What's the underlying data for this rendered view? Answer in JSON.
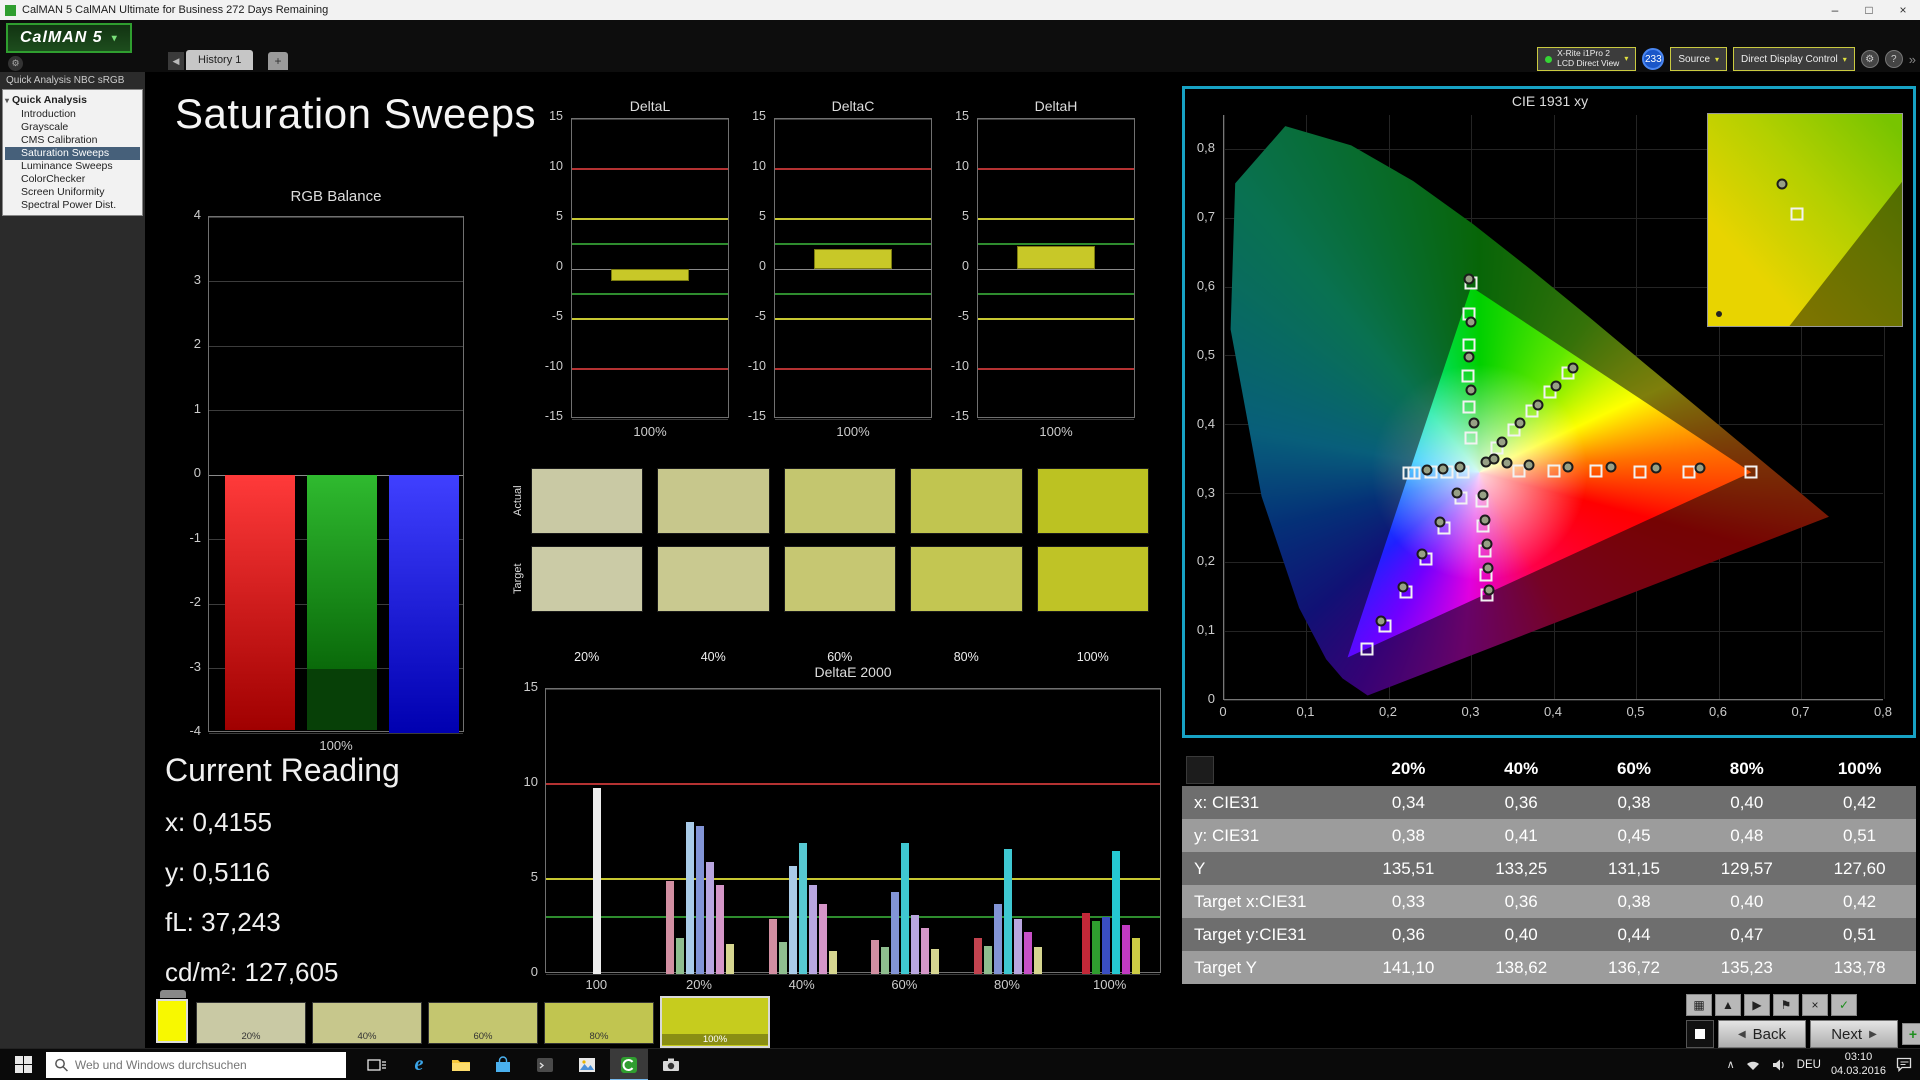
{
  "window": {
    "title": "CalMAN 5 CalMAN Ultimate for Business 272 Days Remaining",
    "controls": {
      "minimize": "–",
      "maximize": "□",
      "close": "×"
    }
  },
  "header": {
    "logo": "CalMAN 5",
    "history_tab": "History 1",
    "add_tab": "+",
    "meter": {
      "line1": "X-Rite i1Pro 2",
      "line2": "LCD Direct View"
    },
    "badge": "233",
    "source": "Source",
    "display_control": "Direct Display Control",
    "help": "?"
  },
  "sidebar": {
    "workflow_title": "Quick Analysis NBC sRGB",
    "root": "Quick Analysis",
    "items": [
      {
        "label": "Introduction",
        "selected": false
      },
      {
        "label": "Grayscale",
        "selected": false
      },
      {
        "label": "CMS Calibration",
        "selected": false
      },
      {
        "label": "Saturation Sweeps",
        "selected": true
      },
      {
        "label": "Luminance Sweeps",
        "selected": false
      },
      {
        "label": "ColorChecker",
        "selected": false
      },
      {
        "label": "Screen Uniformity",
        "selected": false
      },
      {
        "label": "Spectral Power Dist.",
        "selected": false
      }
    ]
  },
  "page": {
    "title": "Saturation Sweeps"
  },
  "charts": {
    "rgb_balance": {
      "title": "RGB Balance",
      "ylim": [
        -4,
        4
      ],
      "yticks": [
        4,
        3,
        2,
        1,
        0,
        -1,
        -2,
        -3,
        -4
      ],
      "xlabel": "100%",
      "bars": [
        {
          "name": "red",
          "value": -3.95,
          "color_top": "#ff3a3a",
          "color_bottom": "#a00000"
        },
        {
          "name": "green",
          "value": -3.0,
          "color_top": "#2fba2f",
          "color_bottom": "#0a6a0a",
          "tail_value": -3.95,
          "tail_color": "#074007"
        },
        {
          "name": "blue",
          "value": -4.0,
          "color_top": "#4040ff",
          "color_bottom": "#0000b0"
        }
      ]
    },
    "delta_axis": {
      "ylim": [
        -15,
        15
      ],
      "yticks": [
        15,
        10,
        5,
        0,
        -5,
        -10,
        -15
      ],
      "xlabel": "100%",
      "bar_color": "#c8c828",
      "ref_lines": [
        {
          "y": 10,
          "color": "#b43232"
        },
        {
          "y": 5,
          "color": "#c8c832"
        },
        {
          "y": 2.5,
          "color": "#2e8c2e"
        },
        {
          "y": -2.5,
          "color": "#2e8c2e"
        },
        {
          "y": -5,
          "color": "#c8c832"
        },
        {
          "y": -10,
          "color": "#b43232"
        }
      ]
    },
    "delta_charts": [
      {
        "title": "DeltaL",
        "value": -1.2
      },
      {
        "title": "DeltaC",
        "value": 2.0
      },
      {
        "title": "DeltaH",
        "value": 2.3
      }
    ],
    "delta_e": {
      "title": "DeltaE 2000",
      "ylim": [
        0,
        15
      ],
      "yticks": [
        15,
        10,
        5,
        0
      ],
      "ref_lines": [
        {
          "y": 10,
          "color": "#b43232"
        },
        {
          "y": 5,
          "color": "#c8c832"
        },
        {
          "y": 3,
          "color": "#2e8c2e"
        }
      ],
      "groups": [
        {
          "label": "100",
          "bars": [
            {
              "v": 9.8,
              "c": "#ededed"
            }
          ]
        },
        {
          "label": "20%",
          "bars": [
            {
              "v": 4.9,
              "c": "#d28fa2"
            },
            {
              "v": 1.9,
              "c": "#8fbe8f"
            },
            {
              "v": 8.0,
              "c": "#a9cbe8"
            },
            {
              "v": 7.8,
              "c": "#8294d6"
            },
            {
              "v": 5.9,
              "c": "#b9a6e0"
            },
            {
              "v": 4.7,
              "c": "#d596c8"
            },
            {
              "v": 1.6,
              "c": "#d6d690"
            }
          ]
        },
        {
          "label": "40%",
          "bars": [
            {
              "v": 2.9,
              "c": "#d28fa2"
            },
            {
              "v": 1.7,
              "c": "#8fbe8f"
            },
            {
              "v": 5.7,
              "c": "#a9cbe8"
            },
            {
              "v": 6.9,
              "c": "#57c8d2"
            },
            {
              "v": 4.7,
              "c": "#b9a6e0"
            },
            {
              "v": 3.7,
              "c": "#d596c8"
            },
            {
              "v": 1.2,
              "c": "#d6d690"
            }
          ]
        },
        {
          "label": "60%",
          "bars": [
            {
              "v": 1.8,
              "c": "#d28fa2"
            },
            {
              "v": 1.4,
              "c": "#8fbe8f"
            },
            {
              "v": 4.3,
              "c": "#8294d6"
            },
            {
              "v": 6.9,
              "c": "#3fc8d2"
            },
            {
              "v": 3.1,
              "c": "#b9a6e0"
            },
            {
              "v": 2.4,
              "c": "#d596c8"
            },
            {
              "v": 1.3,
              "c": "#d6d690"
            }
          ]
        },
        {
          "label": "80%",
          "bars": [
            {
              "v": 1.9,
              "c": "#c2434f"
            },
            {
              "v": 1.5,
              "c": "#8fbe8f"
            },
            {
              "v": 3.7,
              "c": "#8294d6"
            },
            {
              "v": 6.6,
              "c": "#3fc8d2"
            },
            {
              "v": 2.9,
              "c": "#b9a6e0"
            },
            {
              "v": 2.2,
              "c": "#c850c8"
            },
            {
              "v": 1.4,
              "c": "#d6d690"
            }
          ]
        },
        {
          "label": "100%",
          "bars": [
            {
              "v": 3.2,
              "c": "#c22838"
            },
            {
              "v": 2.8,
              "c": "#2f9e2f"
            },
            {
              "v": 3.0,
              "c": "#3a4ec2"
            },
            {
              "v": 6.5,
              "c": "#25c8d2"
            },
            {
              "v": 2.6,
              "c": "#c23ac2"
            },
            {
              "v": 1.9,
              "c": "#cccc44"
            }
          ]
        }
      ]
    }
  },
  "swatches": {
    "row_labels": [
      "Actual",
      "Target"
    ],
    "col_labels": [
      "20%",
      "40%",
      "60%",
      "80%",
      "100%"
    ],
    "actual": [
      "#c9c9a4",
      "#c7c78c",
      "#c4c66f",
      "#c1c550",
      "#bcc222"
    ],
    "target": [
      "#cbcba6",
      "#c9c990",
      "#c6c772",
      "#c3c652",
      "#bfc326"
    ]
  },
  "current_reading": {
    "title": "Current Reading",
    "x": "x: 0,4155",
    "y": "y: 0,5116",
    "fl": "fL: 37,243",
    "cdm2": "cd/m²: 127,605"
  },
  "cie": {
    "title": "CIE 1931 xy",
    "xticks": [
      "0",
      "0,1",
      "0,2",
      "0,3",
      "0,4",
      "0,5",
      "0,6",
      "0,7",
      "0,8"
    ],
    "yticks": [
      "0",
      "0,1",
      "0,2",
      "0,3",
      "0,4",
      "0,5",
      "0,6",
      "0,7",
      "0,8"
    ],
    "targets": [
      [
        0.3,
        0.605
      ],
      [
        0.298,
        0.56
      ],
      [
        0.297,
        0.515
      ],
      [
        0.296,
        0.47
      ],
      [
        0.298,
        0.425
      ],
      [
        0.3,
        0.38
      ],
      [
        0.418,
        0.475
      ],
      [
        0.396,
        0.447
      ],
      [
        0.374,
        0.419
      ],
      [
        0.352,
        0.392
      ],
      [
        0.331,
        0.365
      ],
      [
        0.64,
        0.33
      ],
      [
        0.565,
        0.331
      ],
      [
        0.505,
        0.331
      ],
      [
        0.452,
        0.332
      ],
      [
        0.4,
        0.332
      ],
      [
        0.358,
        0.332
      ],
      [
        0.29,
        0.331
      ],
      [
        0.271,
        0.33
      ],
      [
        0.251,
        0.33
      ],
      [
        0.231,
        0.329
      ],
      [
        0.224,
        0.329
      ],
      [
        0.288,
        0.292
      ],
      [
        0.267,
        0.249
      ],
      [
        0.245,
        0.204
      ],
      [
        0.221,
        0.156
      ],
      [
        0.196,
        0.106
      ],
      [
        0.174,
        0.073
      ],
      [
        0.313,
        0.288
      ],
      [
        0.315,
        0.252
      ],
      [
        0.317,
        0.216
      ],
      [
        0.318,
        0.18
      ],
      [
        0.319,
        0.152
      ]
    ],
    "measured": [
      [
        0.297,
        0.612
      ],
      [
        0.3,
        0.548
      ],
      [
        0.298,
        0.498
      ],
      [
        0.3,
        0.45
      ],
      [
        0.303,
        0.402
      ],
      [
        0.424,
        0.482
      ],
      [
        0.403,
        0.455
      ],
      [
        0.381,
        0.428
      ],
      [
        0.359,
        0.401
      ],
      [
        0.338,
        0.374
      ],
      [
        0.578,
        0.336
      ],
      [
        0.524,
        0.336
      ],
      [
        0.47,
        0.337
      ],
      [
        0.417,
        0.338
      ],
      [
        0.37,
        0.341
      ],
      [
        0.344,
        0.344
      ],
      [
        0.286,
        0.337
      ],
      [
        0.266,
        0.335
      ],
      [
        0.247,
        0.334
      ],
      [
        0.283,
        0.3
      ],
      [
        0.262,
        0.257
      ],
      [
        0.24,
        0.211
      ],
      [
        0.217,
        0.163
      ],
      [
        0.191,
        0.113
      ],
      [
        0.315,
        0.297
      ],
      [
        0.317,
        0.261
      ],
      [
        0.319,
        0.226
      ],
      [
        0.32,
        0.19
      ],
      [
        0.322,
        0.158
      ],
      [
        0.318,
        0.345
      ],
      [
        0.328,
        0.35
      ]
    ]
  },
  "table": {
    "headers": [
      "",
      "20%",
      "40%",
      "60%",
      "80%",
      "100%"
    ],
    "rows": [
      {
        "label": "x: CIE31",
        "values": [
          "0,34",
          "0,36",
          "0,38",
          "0,40",
          "0,42"
        ]
      },
      {
        "label": "y: CIE31",
        "values": [
          "0,38",
          "0,41",
          "0,45",
          "0,48",
          "0,51"
        ]
      },
      {
        "label": "Y",
        "values": [
          "135,51",
          "133,25",
          "131,15",
          "129,57",
          "127,60"
        ]
      },
      {
        "label": "Target x:CIE31",
        "values": [
          "0,33",
          "0,36",
          "0,38",
          "0,40",
          "0,42"
        ]
      },
      {
        "label": "Target y:CIE31",
        "values": [
          "0,36",
          "0,40",
          "0,44",
          "0,47",
          "0,51"
        ]
      },
      {
        "label": "Target Y",
        "values": [
          "141,10",
          "138,62",
          "136,72",
          "135,23",
          "133,78"
        ]
      }
    ]
  },
  "footer": {
    "current_swatch_color": "#f8f800",
    "thumbs": [
      {
        "label": "20%",
        "color": "#c9c9a4",
        "active": false
      },
      {
        "label": "40%",
        "color": "#c7c78c",
        "active": false
      },
      {
        "label": "60%",
        "color": "#c4c66f",
        "active": false
      },
      {
        "label": "80%",
        "color": "#c1c550",
        "active": false
      },
      {
        "label": "100%",
        "color": "#c6cc1e",
        "active": true
      }
    ],
    "nav_icons": [
      {
        "name": "layout",
        "glyph": "▦"
      },
      {
        "name": "up",
        "glyph": "▲"
      },
      {
        "name": "play",
        "glyph": "▶"
      },
      {
        "name": "flag",
        "glyph": "⚑"
      },
      {
        "name": "close",
        "glyph": "×"
      },
      {
        "name": "check",
        "glyph": "✓",
        "color": "#1e8e1e"
      }
    ],
    "back": "Back",
    "next": "Next",
    "add": "+"
  },
  "taskbar": {
    "search_placeholder": "Web und Windows durchsuchen",
    "apps": [
      {
        "name": "task-view",
        "active": false
      },
      {
        "name": "edge",
        "active": false
      },
      {
        "name": "file-explorer",
        "active": false
      },
      {
        "name": "store",
        "active": false
      },
      {
        "name": "console",
        "active": false
      },
      {
        "name": "photos",
        "active": false
      },
      {
        "name": "calman",
        "active": true
      },
      {
        "name": "camera",
        "active": false
      }
    ],
    "tray": {
      "expand": "∧",
      "lang": "DEU",
      "time": "03:10",
      "date": "04.03.2016"
    }
  }
}
